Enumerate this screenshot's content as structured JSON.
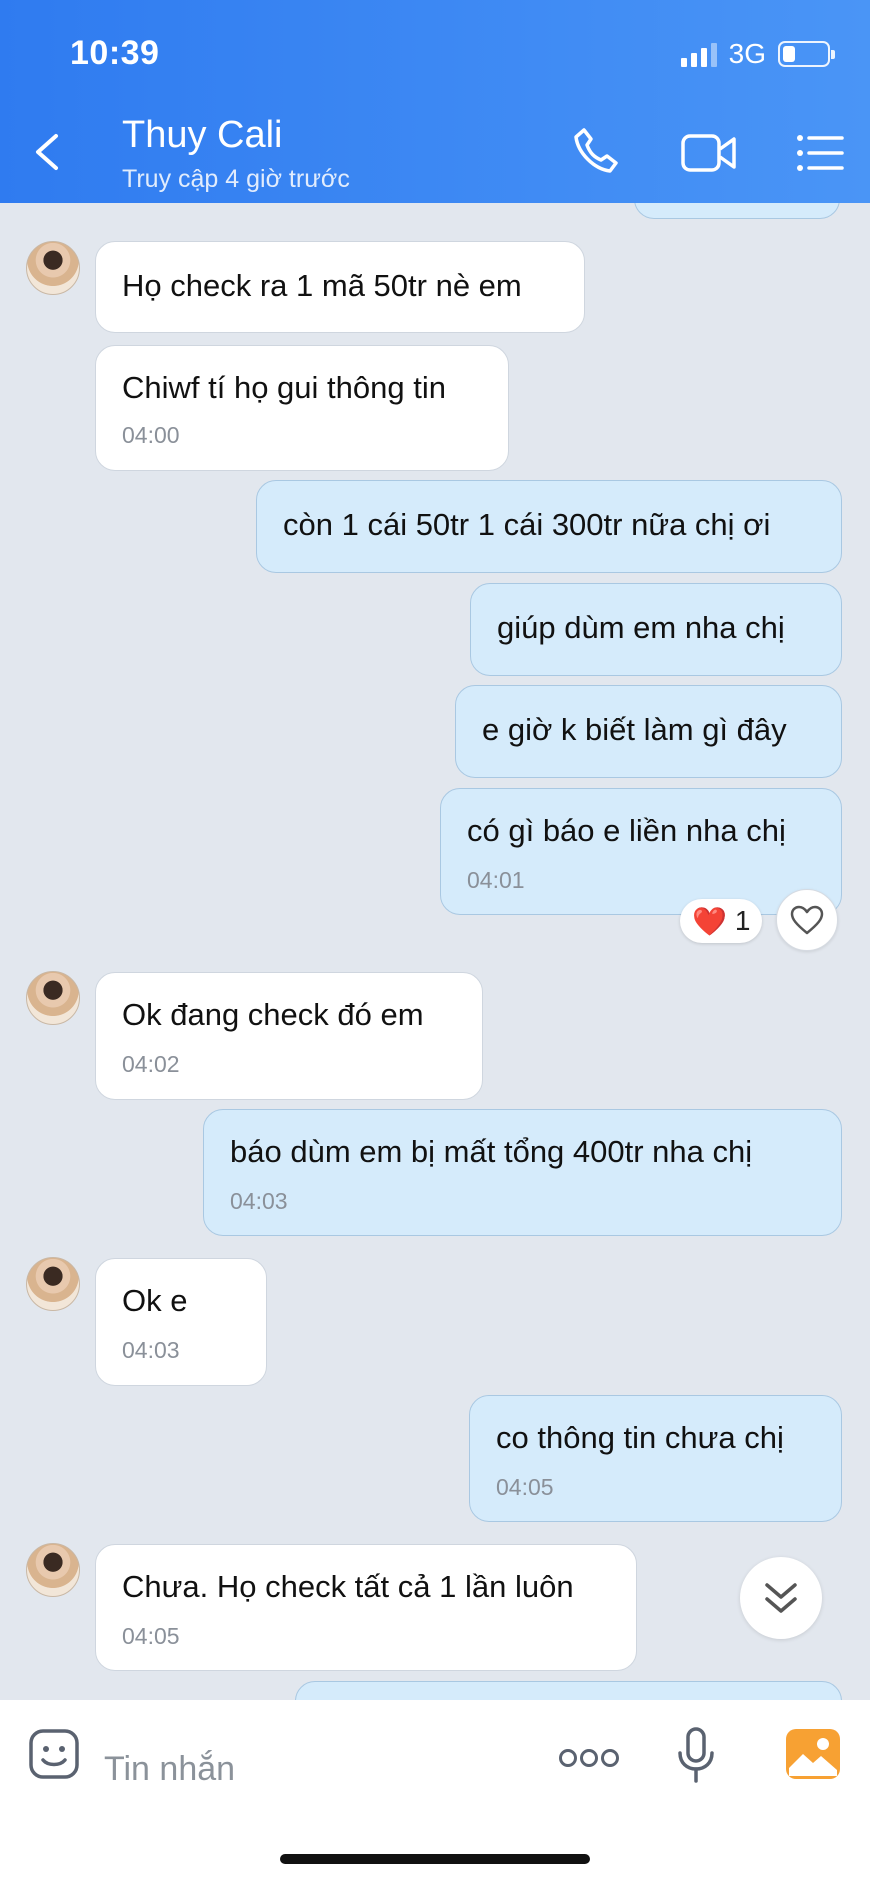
{
  "status_bar": {
    "time": "10:39",
    "network": "3G"
  },
  "header": {
    "contact_name": "Thuy Cali",
    "last_seen": "Truy cập 4 giờ trước"
  },
  "messages": [
    {
      "side": "in",
      "text": "Họ check ra 1 mã 50tr nè em",
      "time": ""
    },
    {
      "side": "in",
      "text": "Chiwf tí họ gui thông tin",
      "time": "04:00"
    },
    {
      "side": "out",
      "text": "còn 1 cái 50tr 1 cái 300tr nữa chị ơi",
      "time": ""
    },
    {
      "side": "out",
      "text": "giúp dùm em nha chị",
      "time": ""
    },
    {
      "side": "out",
      "text": "e giờ k biết làm gì đây",
      "time": ""
    },
    {
      "side": "out",
      "text": "có gì báo e liền nha chị",
      "time": "04:01"
    },
    {
      "side": "in",
      "text": "Ok đang check đó em",
      "time": "04:02"
    },
    {
      "side": "out",
      "text": "báo dùm em bị mất tổng 400tr nha chị",
      "time": "04:03"
    },
    {
      "side": "in",
      "text": "Ok e",
      "time": "04:03"
    },
    {
      "side": "out",
      "text": "co thông tin chưa chị",
      "time": "04:05"
    },
    {
      "side": "in",
      "text": "Chưa. Họ check tất cả 1 lần luôn",
      "time": "04:05"
    }
  ],
  "reaction": {
    "emoji": "❤️",
    "count": "1"
  },
  "input": {
    "placeholder": "Tin nhắn"
  },
  "icons": {
    "back": "chevron-left-icon",
    "call": "phone-icon",
    "video": "video-camera-icon",
    "menu": "list-icon",
    "emoji": "emoji-icon",
    "more": "more-dots-icon",
    "mic": "microphone-icon",
    "image": "image-icon",
    "like": "heart-outline-icon",
    "scroll": "double-chevron-down-icon"
  },
  "colors": {
    "header": "#3a86f3",
    "outgoing_bubble": "#d5ebfb",
    "incoming_bubble": "#ffffff",
    "chat_bg": "#e2e7ee"
  }
}
